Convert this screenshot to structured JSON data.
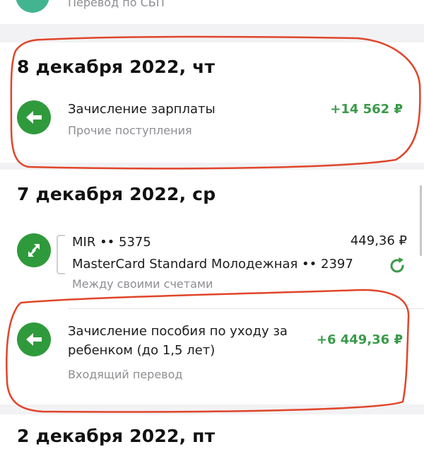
{
  "top": {
    "partial_subtitle": "Перевод по СБП"
  },
  "groups": [
    {
      "date": "8 декабря 2022, чт",
      "items": [
        {
          "title": "Зачисление зарплаты",
          "subtitle": "Прочие поступления",
          "amount": "+14 562 ₽",
          "icon": "arrow-left-icon"
        }
      ]
    },
    {
      "date": "7 декабря 2022, ср",
      "items": [
        {
          "line1": "MIR •• 5375",
          "line2": "MasterCard Standard Молодежная •• 2397",
          "subtitle": "Между своими счетами",
          "amount": "449,36 ₽",
          "icon": "transfer-arrows-icon",
          "status_icon": "refresh-icon"
        },
        {
          "title_line1": "Зачисление пособия по уходу за",
          "title_line2": "ребенком (до 1,5 лет)",
          "subtitle": "Входящий перевод",
          "amount": "+6 449,36 ₽",
          "icon": "arrow-left-icon"
        }
      ]
    },
    {
      "date": "2 декабря 2022, пт"
    }
  ],
  "colors": {
    "accent_green": "#2f9a3c",
    "amount_green": "#3a9a4a",
    "annotation_red": "#e0452a"
  }
}
